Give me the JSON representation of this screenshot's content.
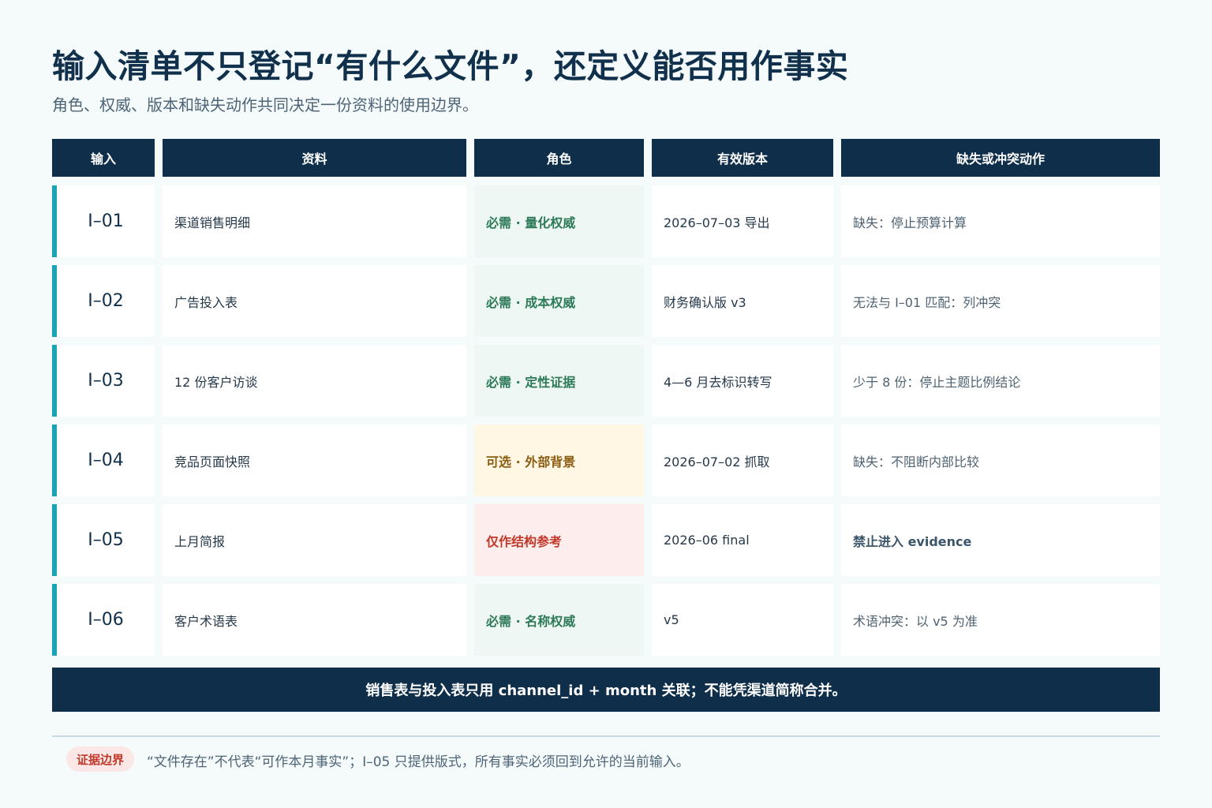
{
  "title": "输入清单不只登记“有什么文件”，还定义能否用作事实",
  "subtitle": "角色、权威、版本和缺失动作共同决定一份资料的使用边界。",
  "table": {
    "headers": [
      "输入",
      "资料",
      "角色",
      "有效版本",
      "缺失或冲突动作"
    ],
    "rows": [
      {
        "id": "I–01",
        "material": "渠道销售明细",
        "role": "必需 · 量化权威",
        "role_tone": "green",
        "version": "2026–07–03 导出",
        "action": "缺失：停止预算计算",
        "action_strong": false
      },
      {
        "id": "I–02",
        "material": "广告投入表",
        "role": "必需 · 成本权威",
        "role_tone": "green",
        "version": "财务确认版 v3",
        "action": "无法与 I–01 匹配：列冲突",
        "action_strong": false
      },
      {
        "id": "I–03",
        "material": "12 份客户访谈",
        "role": "必需 · 定性证据",
        "role_tone": "green",
        "version": "4—6 月去标识转写",
        "action": "少于 8 份：停止主题比例结论",
        "action_strong": false
      },
      {
        "id": "I–04",
        "material": "竞品页面快照",
        "role": "可选 · 外部背景",
        "role_tone": "amber",
        "version": "2026–07–02 抓取",
        "action": "缺失：不阻断内部比较",
        "action_strong": false
      },
      {
        "id": "I–05",
        "material": "上月简报",
        "role": "仅作结构参考",
        "role_tone": "red",
        "version": "2026–06 final",
        "action": "禁止进入 evidence",
        "action_strong": true
      },
      {
        "id": "I–06",
        "material": "客户术语表",
        "role": "必需 · 名称权威",
        "role_tone": "green",
        "version": "v5",
        "action": "术语冲突：以 v5 为准",
        "action_strong": false
      }
    ]
  },
  "banner": "销售表与投入表只用 channel_id + month 关联；不能凭渠道简称合并。",
  "footer": {
    "badge": "证据边界",
    "note": "“文件存在”不代表“可作本月事实”；I–05 只提供版式，所有事实必须回到允许的当前输入。"
  },
  "colors": {
    "header_bg": "#0f2e4a",
    "accent_bar": "#1aa3b7",
    "role_green": "#2c7a58",
    "role_amber": "#8a5d12",
    "role_red": "#c0392b"
  }
}
